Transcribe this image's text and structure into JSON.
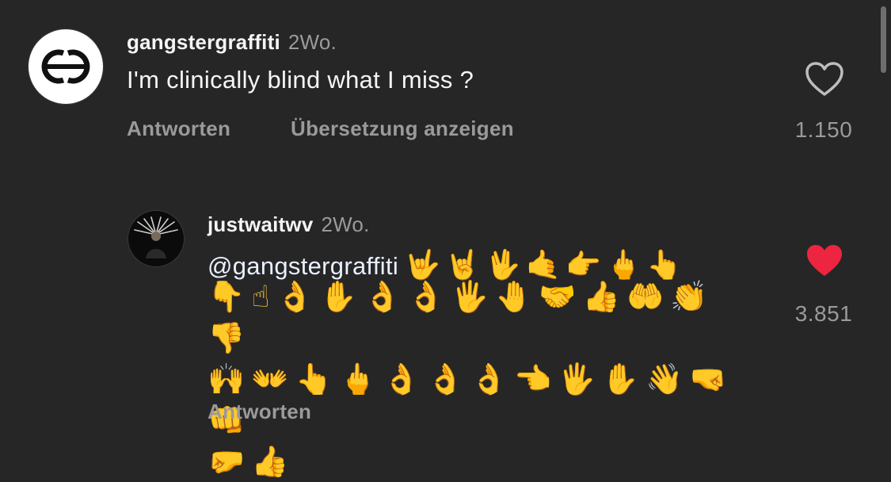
{
  "comment": {
    "username": "gangstergraffiti",
    "timestamp": "2Wo.",
    "text": "I'm clinically blind what I miss ?",
    "reply_label": "Antworten",
    "translate_label": "Übersetzung anzeigen",
    "like_count": "1.150",
    "liked": false,
    "avatar_icon": "gg-logo-icon"
  },
  "reply": {
    "username": "justwaitwv",
    "timestamp": "2Wo.",
    "mention": "@gangstergraffiti",
    "emoji_inline": "🤟🤘🖖🤙👉🖕👆",
    "emoji_lines": [
      "👇☝👌✋👌👌🖐🤚🤝👍🤲👏👎",
      "🙌👐👆🖕👌👌👌👈🖐✋👋🤜👊",
      "🤛👍"
    ],
    "reply_label": "Antworten",
    "like_count": "3.851",
    "liked": true,
    "avatar_icon": "portrait-avatar-icon"
  },
  "colors": {
    "background": "#262626",
    "heart_active": "#ed2540",
    "muted_text": "#9a9a9a"
  }
}
